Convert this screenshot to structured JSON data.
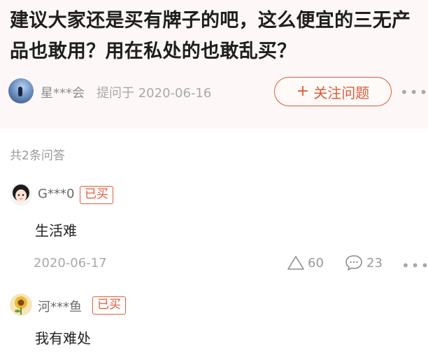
{
  "question": {
    "title": "建议大家还是买有牌子的吧，这么便宜的三无产品也敢用？用在私处的也敢乱买？",
    "asker_name": "星***会",
    "asked_on": "提问于 2020-06-16",
    "follow_label": "关注问题",
    "follow_icon": "plus-icon",
    "more_icon": "more-horizontal-icon"
  },
  "answer_count_label": "共2条问答",
  "answers": [
    {
      "user": "G***0",
      "badge": "已买",
      "text": "生活难",
      "date": "2020-06-17",
      "likes": "60",
      "comments": "23",
      "avatar_icon": "cartoon-girl-avatar"
    },
    {
      "user": "河***鱼",
      "badge": "已买",
      "text": "我有难处",
      "avatar_icon": "sunflower-avatar"
    }
  ],
  "colors": {
    "accent": "#e05a3a",
    "header_bg": "#fdf7f7",
    "muted_text": "#9a9a9a"
  }
}
